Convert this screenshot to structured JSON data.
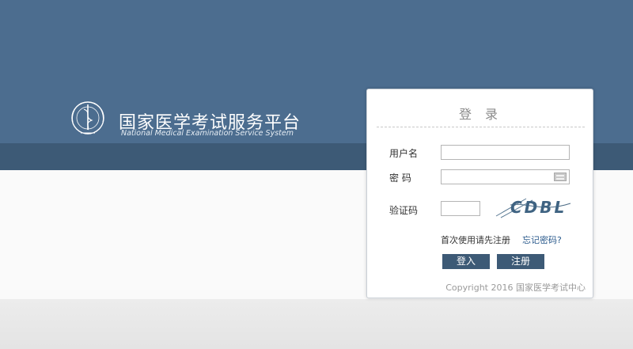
{
  "brand": {
    "title_cn": "国家医学考试服务平台",
    "title_en": "National Medical Examination Service System",
    "logo_icon": "medical-caduceus-icon"
  },
  "login": {
    "title": "登 录",
    "username_label": "用户名",
    "username_value": "",
    "password_label": "密 码",
    "password_value": "",
    "captcha_label": "验证码",
    "captcha_value": "",
    "captcha_text": "CDBL",
    "first_use_text": "首次使用请先注册",
    "forgot_password": "忘记密码?",
    "login_button": "登入",
    "register_button": "注册",
    "copyright": "Copyright 2016 国家医学考试中心"
  },
  "colors": {
    "header_blue": "#4c6d8f",
    "header_dark": "#3d5a76",
    "button": "#3d5a76",
    "link": "#2a5a8c"
  }
}
